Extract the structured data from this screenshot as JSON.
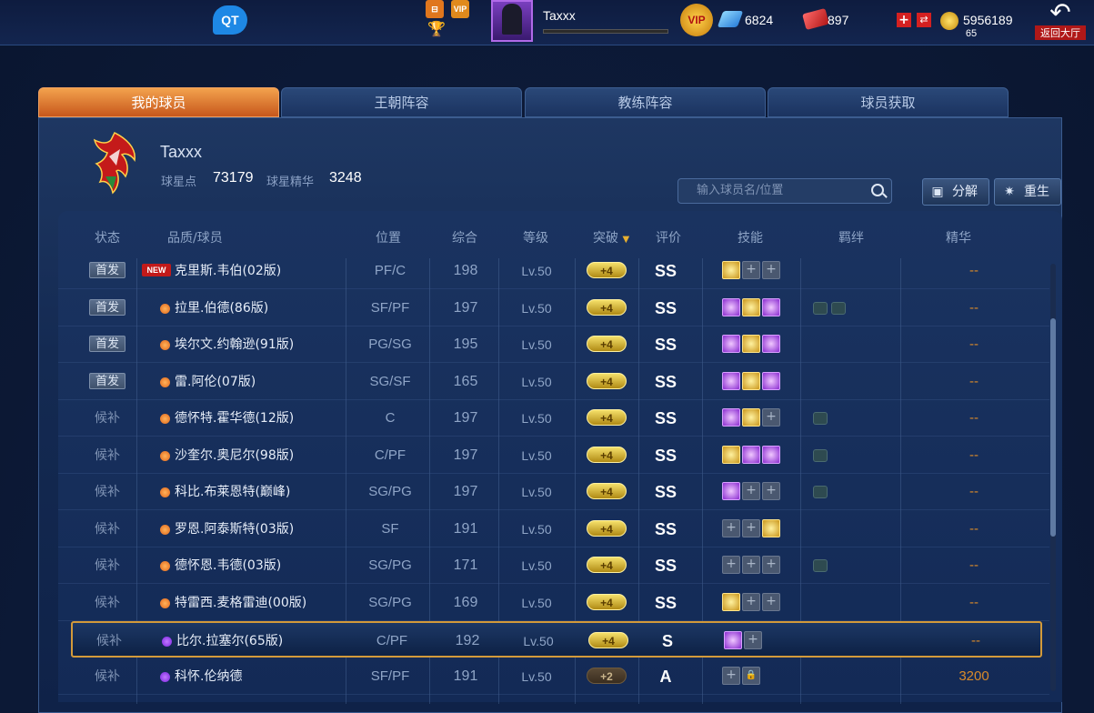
{
  "topbar": {
    "qt_label": "QT",
    "username": "Taxxx",
    "avatar_level": "65",
    "vip_label": "VIP",
    "gems": "6824",
    "tickets": "897",
    "coins": "5956189",
    "back_label": "返回大厅",
    "mini_vip": "VIP"
  },
  "tabs": [
    "我的球员",
    "王朝阵容",
    "教练阵容",
    "球员获取"
  ],
  "profile": {
    "name": "Taxxx",
    "star_points_label": "球星点",
    "star_points": "73179",
    "star_essence_label": "球星精华",
    "star_essence": "3248"
  },
  "search": {
    "placeholder": "输入球员名/位置"
  },
  "buttons": {
    "decompose": "分解",
    "rebirth": "重生"
  },
  "headers": {
    "status": "状态",
    "quality_player": "品质/球员",
    "position": "位置",
    "overall": "综合",
    "level": "等级",
    "breakthrough": "突破",
    "rating": "评价",
    "skills": "技能",
    "bonds": "羁绊",
    "essence": "精华"
  },
  "rows": [
    {
      "status": "首发",
      "starter": true,
      "new": true,
      "new_label": "NEW",
      "quality": "none",
      "name": "克里斯.韦伯(02版)",
      "pos": "PF/C",
      "ovr": "198",
      "lvl": "Lv.50",
      "brk": "+4",
      "brk_style": "gold",
      "grade": "SS",
      "skills": [
        "gold",
        "empty",
        "empty"
      ],
      "bonds": 0,
      "essence": "--"
    },
    {
      "status": "首发",
      "starter": true,
      "new": false,
      "quality": "orange",
      "name": "拉里.伯德(86版)",
      "pos": "SF/PF",
      "ovr": "197",
      "lvl": "Lv.50",
      "brk": "+4",
      "brk_style": "gold",
      "grade": "SS",
      "skills": [
        "purple",
        "gold",
        "purple"
      ],
      "bonds": 2,
      "essence": "--"
    },
    {
      "status": "首发",
      "starter": true,
      "new": false,
      "quality": "orange",
      "name": "埃尔文.约翰逊(91版)",
      "pos": "PG/SG",
      "ovr": "195",
      "lvl": "Lv.50",
      "brk": "+4",
      "brk_style": "gold",
      "grade": "SS",
      "skills": [
        "purple",
        "gold",
        "purple"
      ],
      "bonds": 0,
      "essence": "--"
    },
    {
      "status": "首发",
      "starter": true,
      "new": false,
      "quality": "orange",
      "name": "雷.阿伦(07版)",
      "pos": "SG/SF",
      "ovr": "165",
      "lvl": "Lv.50",
      "brk": "+4",
      "brk_style": "gold",
      "grade": "SS",
      "skills": [
        "purple",
        "gold",
        "purple"
      ],
      "bonds": 0,
      "essence": "--"
    },
    {
      "status": "候补",
      "starter": false,
      "new": false,
      "quality": "orange",
      "name": "德怀特.霍华德(12版)",
      "pos": "C",
      "ovr": "197",
      "lvl": "Lv.50",
      "brk": "+4",
      "brk_style": "gold",
      "grade": "SS",
      "skills": [
        "purple",
        "gold",
        "empty"
      ],
      "bonds": 1,
      "essence": "--"
    },
    {
      "status": "候补",
      "starter": false,
      "new": false,
      "quality": "orange",
      "name": "沙奎尔.奥尼尔(98版)",
      "pos": "C/PF",
      "ovr": "197",
      "lvl": "Lv.50",
      "brk": "+4",
      "brk_style": "gold",
      "grade": "SS",
      "skills": [
        "gold",
        "purple",
        "purple"
      ],
      "bonds": 1,
      "essence": "--"
    },
    {
      "status": "候补",
      "starter": false,
      "new": false,
      "quality": "orange",
      "name": "科比.布莱恩特(巅峰)",
      "pos": "SG/PG",
      "ovr": "197",
      "lvl": "Lv.50",
      "brk": "+4",
      "brk_style": "gold",
      "grade": "SS",
      "skills": [
        "purple",
        "empty",
        "empty"
      ],
      "bonds": 1,
      "essence": "--"
    },
    {
      "status": "候补",
      "starter": false,
      "new": false,
      "quality": "orange",
      "name": "罗恩.阿泰斯特(03版)",
      "pos": "SF",
      "ovr": "191",
      "lvl": "Lv.50",
      "brk": "+4",
      "brk_style": "gold",
      "grade": "SS",
      "skills": [
        "empty",
        "empty",
        "gold"
      ],
      "bonds": 0,
      "essence": "--"
    },
    {
      "status": "候补",
      "starter": false,
      "new": false,
      "quality": "orange",
      "name": "德怀恩.韦德(03版)",
      "pos": "SG/PG",
      "ovr": "171",
      "lvl": "Lv.50",
      "brk": "+4",
      "brk_style": "gold",
      "grade": "SS",
      "skills": [
        "empty",
        "empty",
        "empty"
      ],
      "bonds": 1,
      "essence": "--"
    },
    {
      "status": "候补",
      "starter": false,
      "new": false,
      "quality": "orange",
      "name": "特雷西.麦格雷迪(00版)",
      "pos": "SG/PG",
      "ovr": "169",
      "lvl": "Lv.50",
      "brk": "+4",
      "brk_style": "gold",
      "grade": "SS",
      "skills": [
        "gold",
        "empty",
        "empty"
      ],
      "bonds": 0,
      "essence": "--"
    },
    {
      "status": "候补",
      "starter": false,
      "new": false,
      "quality": "purple",
      "name": "比尔.拉塞尔(65版)",
      "pos": "C/PF",
      "ovr": "192",
      "lvl": "Lv.50",
      "brk": "+4",
      "brk_style": "gold",
      "grade": "S",
      "skills": [
        "purple",
        "empty"
      ],
      "bonds": 0,
      "essence": "--",
      "selected": true
    },
    {
      "status": "候补",
      "starter": false,
      "new": false,
      "quality": "purple",
      "name": "科怀.伦纳德",
      "pos": "SF/PF",
      "ovr": "191",
      "lvl": "Lv.50",
      "brk": "+2",
      "brk_style": "dark",
      "grade": "A",
      "skills": [
        "empty",
        "lock"
      ],
      "bonds": 0,
      "essence": "3200"
    }
  ]
}
